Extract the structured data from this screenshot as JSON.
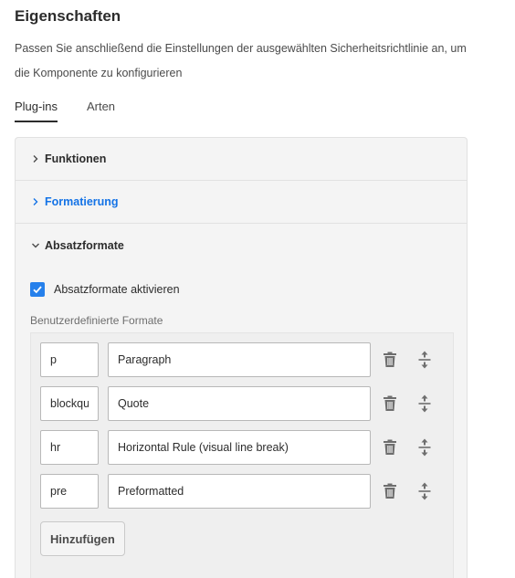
{
  "page": {
    "title": "Eigenschaften",
    "description": "Passen Sie anschließend die Einstellungen der ausgewählten Sicherheitsrichtlinie an, um die Komponente zu konfigurieren"
  },
  "tabs": [
    {
      "label": "Plug-ins",
      "active": true
    },
    {
      "label": "Arten",
      "active": false
    }
  ],
  "accordion": {
    "sections": [
      {
        "label": "Funktionen",
        "expanded": false
      },
      {
        "label": "Formatierung",
        "expanded": false,
        "highlight_color": "#1473e6"
      },
      {
        "label": "Absatzformate",
        "expanded": true
      }
    ],
    "absatzformate": {
      "checkbox_label": "Absatzformate aktivieren",
      "checked": true,
      "formats_label": "Benutzerdefinierte Formate",
      "formats": [
        {
          "tag": "p",
          "description": "Paragraph"
        },
        {
          "tag": "blockquote",
          "description": "Quote"
        },
        {
          "tag": "hr",
          "description": "Horizontal Rule (visual line break)"
        },
        {
          "tag": "pre",
          "description": "Preformatted"
        }
      ],
      "add_label": "Hinzufügen"
    }
  },
  "icons": {
    "collapsed": "chevron-right-icon",
    "expanded": "chevron-down-icon",
    "delete": "trash-icon",
    "reorder": "drag-handle-icon",
    "checkbox": "checkmark-icon"
  },
  "colors": {
    "accent": "#2680eb",
    "link": "#1473e6",
    "panel_bg": "#f4f4f4"
  }
}
